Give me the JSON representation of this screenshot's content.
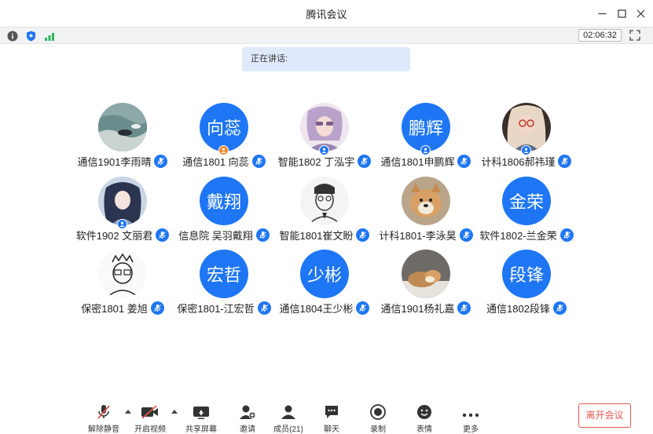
{
  "window": {
    "title": "腾讯会议"
  },
  "infobar": {
    "timer": "02:06:32"
  },
  "speaking": {
    "label": "正在讲话:"
  },
  "participants": [
    {
      "name": "通信1901李雨晴",
      "avatar_text": ""
    },
    {
      "name": "通信1801 向蕊",
      "avatar_text": "向蕊"
    },
    {
      "name": "智能1802  丁泓宇",
      "avatar_text": ""
    },
    {
      "name": "通信1801申鹏辉",
      "avatar_text": "鹏辉"
    },
    {
      "name": "计科1806郝祎瑾",
      "avatar_text": ""
    },
    {
      "name": "软件1902  文丽君",
      "avatar_text": ""
    },
    {
      "name": "信息院 吴羽戴翔",
      "avatar_text": "戴翔"
    },
    {
      "name": "智能1801崔文盼",
      "avatar_text": ""
    },
    {
      "name": "计科1801-李泳昊",
      "avatar_text": ""
    },
    {
      "name": "软件1802-兰金荣",
      "avatar_text": "金荣"
    },
    {
      "name": "保密1801   姜旭",
      "avatar_text": ""
    },
    {
      "name": "保密1801-江宏哲",
      "avatar_text": "宏哲"
    },
    {
      "name": "通信1804王少彬",
      "avatar_text": "少彬"
    },
    {
      "name": "通信1901杨礼嘉",
      "avatar_text": ""
    },
    {
      "name": "通信1802段锋",
      "avatar_text": "段锋"
    }
  ],
  "toolbar": {
    "mute": "解除静音",
    "video": "开启视频",
    "share": "共享屏幕",
    "invite": "邀请",
    "members": "成员(21)",
    "chat": "聊天",
    "record": "录制",
    "emoji": "表情",
    "more": "更多",
    "leave": "离开会议"
  },
  "colors": {
    "accent": "#1e76f5",
    "danger": "#e5584f",
    "host": "#f08a2a"
  }
}
